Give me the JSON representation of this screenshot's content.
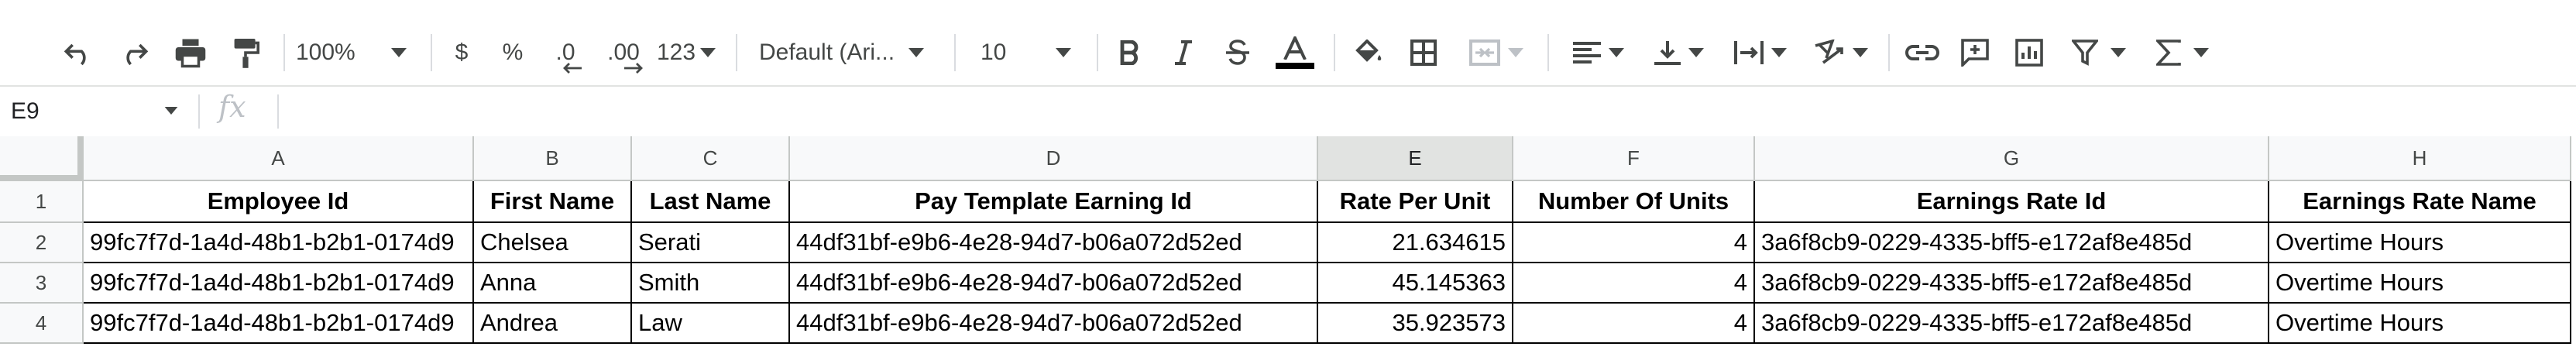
{
  "toolbar": {
    "zoom": "100%",
    "currency": "$",
    "percent": "%",
    "decrease_decimal": ".0",
    "increase_decimal": ".00",
    "more_formats": "123",
    "font": "Default (Ari...",
    "font_size": "10"
  },
  "formula_bar": {
    "cell_ref": "E9",
    "fx": "fx"
  },
  "columns": [
    "A",
    "B",
    "C",
    "D",
    "E",
    "F",
    "G",
    "H"
  ],
  "rows": [
    "1",
    "2",
    "3",
    "4"
  ],
  "header": {
    "employee_id": "Employee Id",
    "first_name": "First Name",
    "last_name": "Last Name",
    "pay_template_earning_id": "Pay Template Earning Id",
    "rate_per_unit": "Rate Per Unit",
    "number_of_units": "Number Of Units",
    "earnings_rate_id": "Earnings Rate Id",
    "earnings_rate_name": "Earnings Rate Name"
  },
  "data": [
    {
      "employee_id": "99fc7f7d-1a4d-48b1-b2b1-0174d9",
      "first_name": "Chelsea",
      "last_name": "Serati",
      "pay_template_earning_id": "44df31bf-e9b6-4e28-94d7-b06a072d52ed",
      "rate_per_unit": "21.634615",
      "number_of_units": "4",
      "earnings_rate_id": "3a6f8cb9-0229-4335-bff5-e172af8e485d",
      "earnings_rate_name": "Overtime Hours"
    },
    {
      "employee_id": "99fc7f7d-1a4d-48b1-b2b1-0174d9",
      "first_name": "Anna",
      "last_name": "Smith",
      "pay_template_earning_id": "44df31bf-e9b6-4e28-94d7-b06a072d52ed",
      "rate_per_unit": "45.145363",
      "number_of_units": "4",
      "earnings_rate_id": "3a6f8cb9-0229-4335-bff5-e172af8e485d",
      "earnings_rate_name": "Overtime Hours"
    },
    {
      "employee_id": "99fc7f7d-1a4d-48b1-b2b1-0174d9",
      "first_name": "Andrea",
      "last_name": "Law",
      "pay_template_earning_id": "44df31bf-e9b6-4e28-94d7-b06a072d52ed",
      "rate_per_unit": "35.923573",
      "number_of_units": "4",
      "earnings_rate_id": "3a6f8cb9-0229-4335-bff5-e172af8e485d",
      "earnings_rate_name": "Overtime Hours"
    }
  ]
}
